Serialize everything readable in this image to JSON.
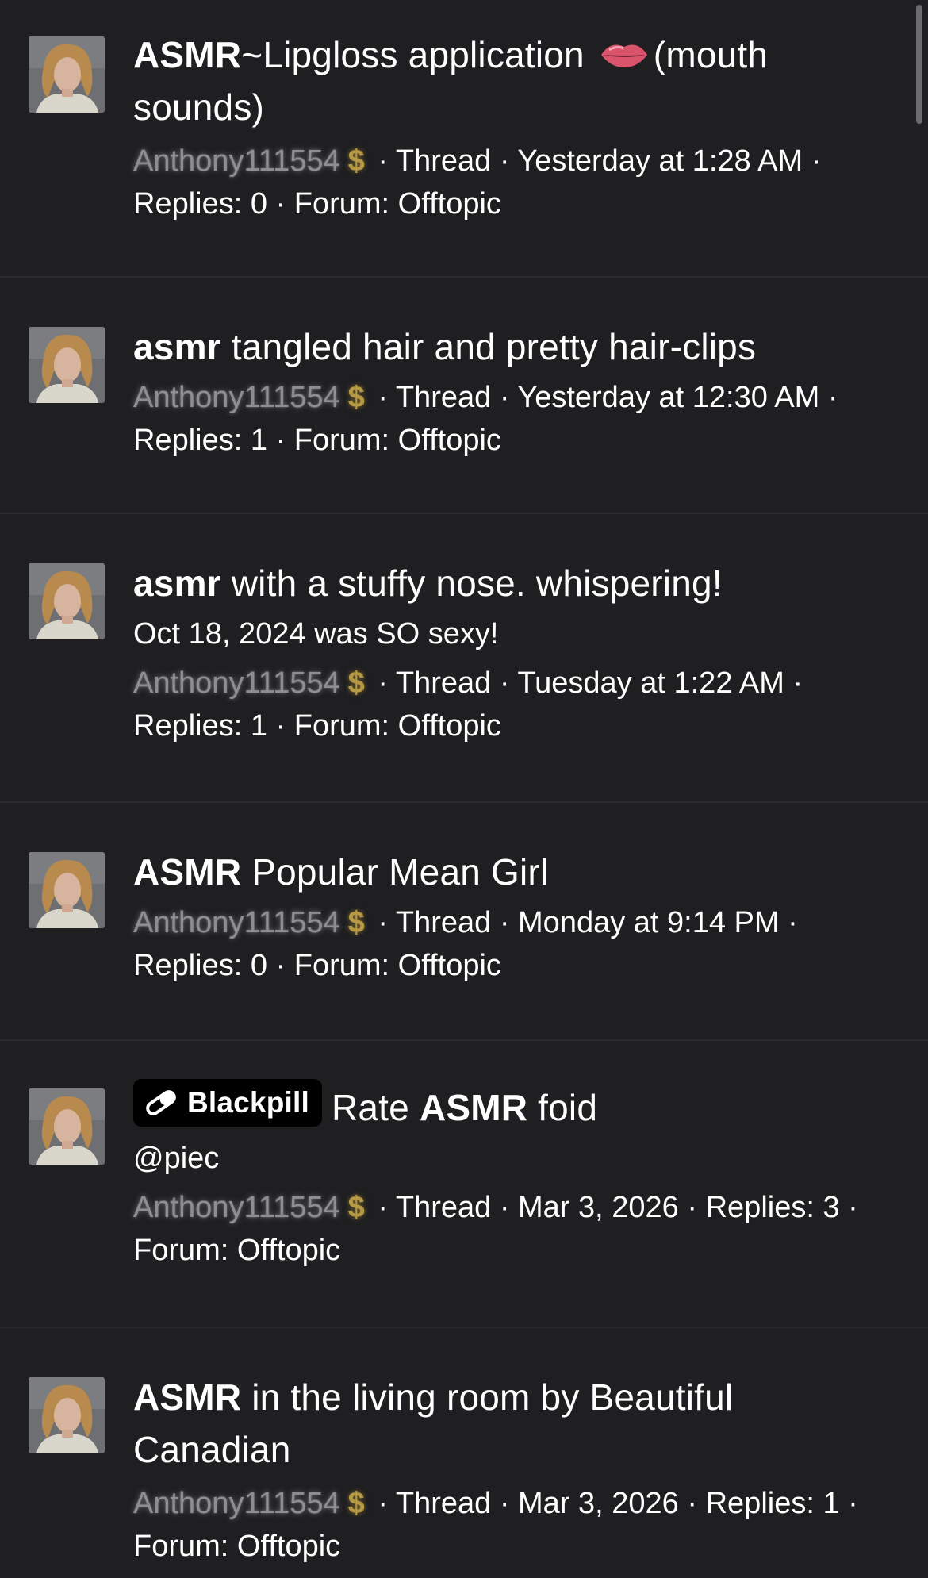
{
  "threads": [
    {
      "title_bold": "ASMR",
      "title_rest_1": "~Lipgloss application",
      "title_icon": "lips-icon",
      "title_rest_2": "(mouth sounds)",
      "username": "Anthony111554",
      "badge_icon": "dollar-icon",
      "type": "Thread",
      "date": "Yesterday at 1:28 AM",
      "replies": "Replies: 0",
      "forum": "Forum: Offtopic"
    },
    {
      "title_bold": "asmr",
      "title_rest": "tangled hair and pretty hair-clips",
      "username": "Anthony111554",
      "type": "Thread",
      "date": "Yesterday at 12:30 AM",
      "replies": "Replies: 1",
      "forum": "Forum: Offtopic"
    },
    {
      "title_bold": "asmr",
      "title_rest": "with a stuffy nose. whispering!",
      "snippet": "Oct 18, 2024 was SO sexy!",
      "username": "Anthony111554",
      "type": "Thread",
      "date": "Tuesday at 1:22 AM",
      "replies": "Replies: 1",
      "forum": "Forum: Offtopic"
    },
    {
      "title_bold": "ASMR",
      "title_rest": "Popular Mean Girl",
      "username": "Anthony111554",
      "type": "Thread",
      "date": "Monday at 9:14 PM",
      "replies": "Replies: 0",
      "forum": "Forum: Offtopic"
    },
    {
      "prefix_label": "Blackpill",
      "prefix_icon": "pill-icon",
      "title_pre": "Rate",
      "title_bold": "ASMR",
      "title_rest": "foid",
      "snippet": "@piec",
      "username": "Anthony111554",
      "type": "Thread",
      "date": "Mar 3, 2026",
      "replies": "Replies: 3",
      "forum": "Forum: Offtopic"
    },
    {
      "title_bold": "ASMR",
      "title_rest": "in the living room by Beautiful Canadian",
      "username": "Anthony111554",
      "type": "Thread",
      "date": "Mar 3, 2026",
      "replies": "Replies: 1",
      "forum": "Forum: Offtopic"
    }
  ],
  "dollar_symbol": "$",
  "separator": "·",
  "colors": {
    "background": "#1f1f21",
    "divider": "#2c2c2f",
    "username": "#8e8e92",
    "badge_gold": "#b79a45"
  }
}
